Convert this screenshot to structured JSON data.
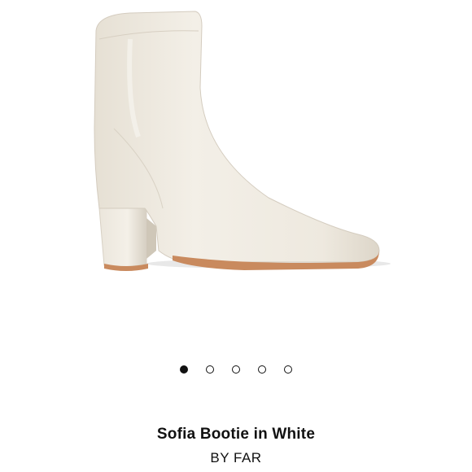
{
  "product": {
    "name": "Sofia Bootie in White",
    "brand": "BY FAR"
  },
  "gallery": {
    "image_count": 5,
    "active_index": 0
  },
  "colors": {
    "boot": "#efeae0",
    "heel_edge": "#c98a5e",
    "dot": "#111111"
  }
}
